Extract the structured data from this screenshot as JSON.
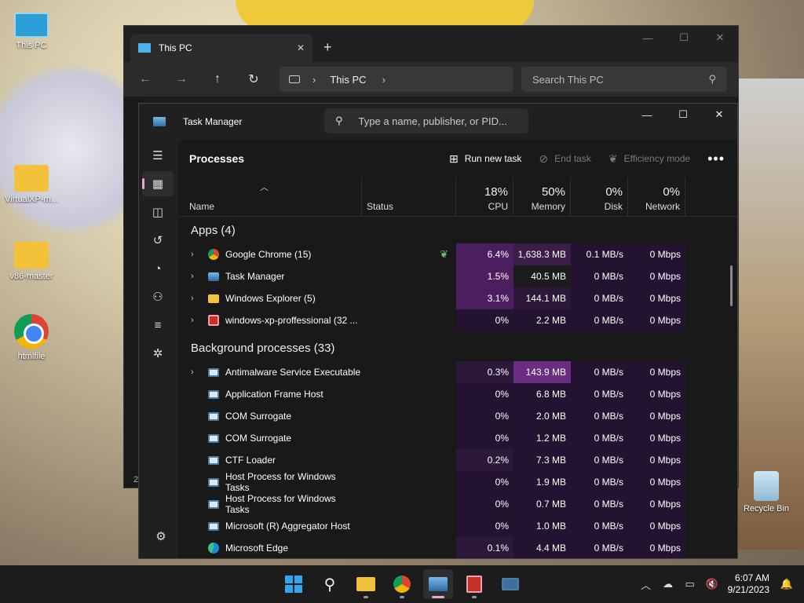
{
  "desktop": {
    "icons": [
      {
        "label": "This PC"
      },
      {
        "label": "VirtualXP-m..."
      },
      {
        "label": "v86-master"
      },
      {
        "label": "htmlfile"
      },
      {
        "label": "Recycle Bin"
      }
    ]
  },
  "explorer": {
    "tab_title": "This PC",
    "tab_close": "✕",
    "new_tab": "+",
    "breadcrumb": "This PC",
    "search_placeholder": "Search This PC",
    "footer": "2"
  },
  "taskmanager": {
    "title": "Task Manager",
    "search_placeholder": "Type a name, publisher, or PID...",
    "page_title": "Processes",
    "toolbar": {
      "run_new_task": "Run new task",
      "end_task": "End task",
      "efficiency_mode": "Efficiency mode",
      "more": "•••"
    },
    "columns": {
      "name": "Name",
      "status": "Status",
      "cpu_pct": "18%",
      "cpu": "CPU",
      "mem_pct": "50%",
      "memory": "Memory",
      "disk_pct": "0%",
      "disk": "Disk",
      "net_pct": "0%",
      "network": "Network"
    },
    "apps_group": "Apps (4)",
    "apps": [
      {
        "name": "Google Chrome (15)",
        "cpu": "6.4%",
        "memory": "1,638.3 MB",
        "disk": "0.1 MB/s",
        "network": "0 Mbps"
      },
      {
        "name": "Task Manager",
        "cpu": "1.5%",
        "memory": "40.5 MB",
        "disk": "0 MB/s",
        "network": "0 Mbps"
      },
      {
        "name": "Windows Explorer (5)",
        "cpu": "3.1%",
        "memory": "144.1 MB",
        "disk": "0 MB/s",
        "network": "0 Mbps"
      },
      {
        "name": "windows-xp-proffessional (32 ...",
        "cpu": "0%",
        "memory": "2.2 MB",
        "disk": "0 MB/s",
        "network": "0 Mbps"
      }
    ],
    "bg_group": "Background processes (33)",
    "background": [
      {
        "name": "Antimalware Service Executable",
        "cpu": "0.3%",
        "memory": "143.9 MB",
        "disk": "0 MB/s",
        "network": "0 Mbps"
      },
      {
        "name": "Application Frame Host",
        "cpu": "0%",
        "memory": "6.8 MB",
        "disk": "0 MB/s",
        "network": "0 Mbps"
      },
      {
        "name": "COM Surrogate",
        "cpu": "0%",
        "memory": "2.0 MB",
        "disk": "0 MB/s",
        "network": "0 Mbps"
      },
      {
        "name": "COM Surrogate",
        "cpu": "0%",
        "memory": "1.2 MB",
        "disk": "0 MB/s",
        "network": "0 Mbps"
      },
      {
        "name": "CTF Loader",
        "cpu": "0.2%",
        "memory": "7.3 MB",
        "disk": "0 MB/s",
        "network": "0 Mbps"
      },
      {
        "name": "Host Process for Windows Tasks",
        "cpu": "0%",
        "memory": "1.9 MB",
        "disk": "0 MB/s",
        "network": "0 Mbps"
      },
      {
        "name": "Host Process for Windows Tasks",
        "cpu": "0%",
        "memory": "0.7 MB",
        "disk": "0 MB/s",
        "network": "0 Mbps"
      },
      {
        "name": "Microsoft (R) Aggregator Host",
        "cpu": "0%",
        "memory": "1.0 MB",
        "disk": "0 MB/s",
        "network": "0 Mbps"
      },
      {
        "name": "Microsoft Edge",
        "cpu": "0.1%",
        "memory": "4.4 MB",
        "disk": "0 MB/s",
        "network": "0 Mbps"
      }
    ]
  },
  "taskbar": {
    "time": "6:07 AM",
    "date": "9/21/2023"
  },
  "colors": {
    "accent": "#e8a8d0",
    "heat_high": "#6a2d82",
    "heat_low": "#241330"
  }
}
